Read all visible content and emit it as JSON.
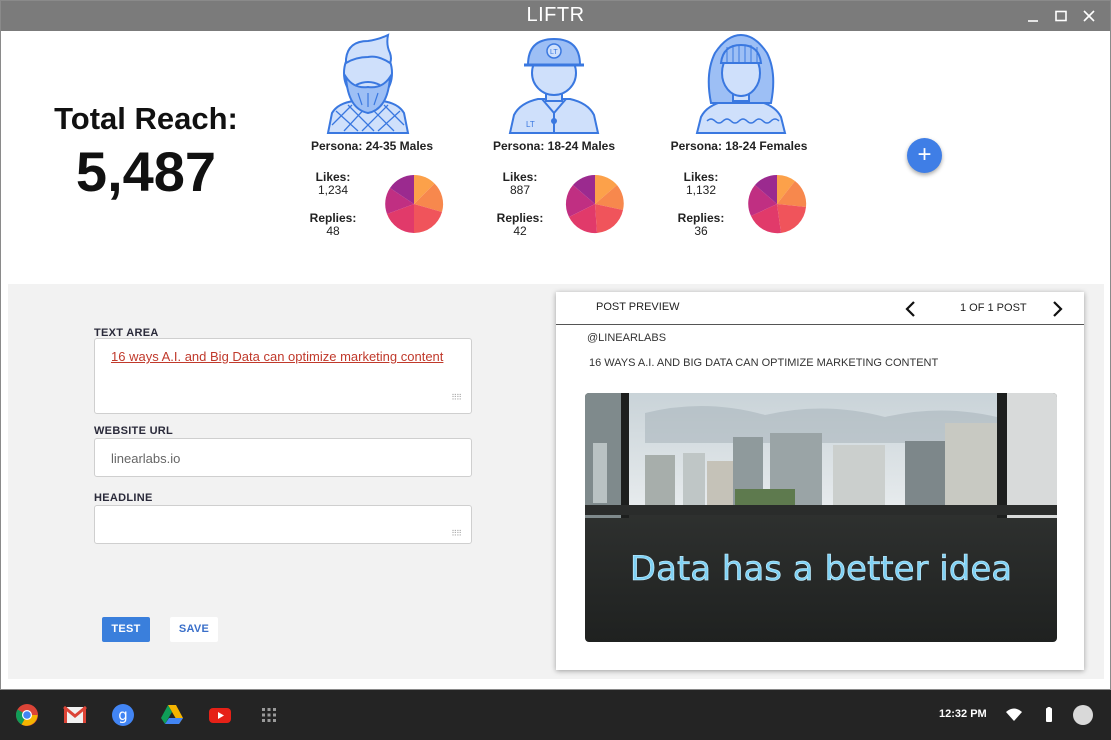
{
  "window": {
    "title": "LIFTR"
  },
  "summary": {
    "label": "Total Reach:",
    "value": "5,487"
  },
  "personas": [
    {
      "name": "Persona: 24-35  Males",
      "likes_label": "Likes:",
      "likes": "1,234",
      "replies_label": "Replies:",
      "replies": "48"
    },
    {
      "name": "Persona: 18-24 Males",
      "likes_label": "Likes:",
      "likes": "887",
      "replies_label": "Replies:",
      "replies": "42"
    },
    {
      "name": "Persona: 18-24 Females",
      "likes_label": "Likes:",
      "likes": "1,132",
      "replies_label": "Replies:",
      "replies": "36"
    }
  ],
  "add_button": {
    "icon": "+"
  },
  "form": {
    "text_area_label": "TEXT AREA",
    "text_area_value": "16 ways A.I. and Big Data can optimize marketing content",
    "website_url_label": "WEBSITE URL",
    "website_url_value": "linearlabs.io",
    "headline_label": "HEADLINE",
    "headline_value": "",
    "test_label": "TEST",
    "save_label": "SAVE"
  },
  "preview": {
    "header": "POST PREVIEW",
    "count": "1 OF 1 POST",
    "handle": "@LINEARLABS",
    "headline": "16 WAYS A.I. AND BIG DATA CAN OPTIMIZE MARKETING CONTENT",
    "image_text": "Data has a better idea"
  },
  "shelf": {
    "apps": [
      "chrome-icon",
      "gmail-icon",
      "google-search-icon",
      "drive-icon",
      "youtube-icon",
      "app-launcher-icon"
    ],
    "time": "12:32 PM"
  },
  "colors": {
    "accent": "#3f7ee6",
    "titlebar": "#7b7b7b",
    "shelf": "#242424",
    "avatar_fill": "#cfe0fb",
    "avatar_stroke": "#3a78e0"
  }
}
